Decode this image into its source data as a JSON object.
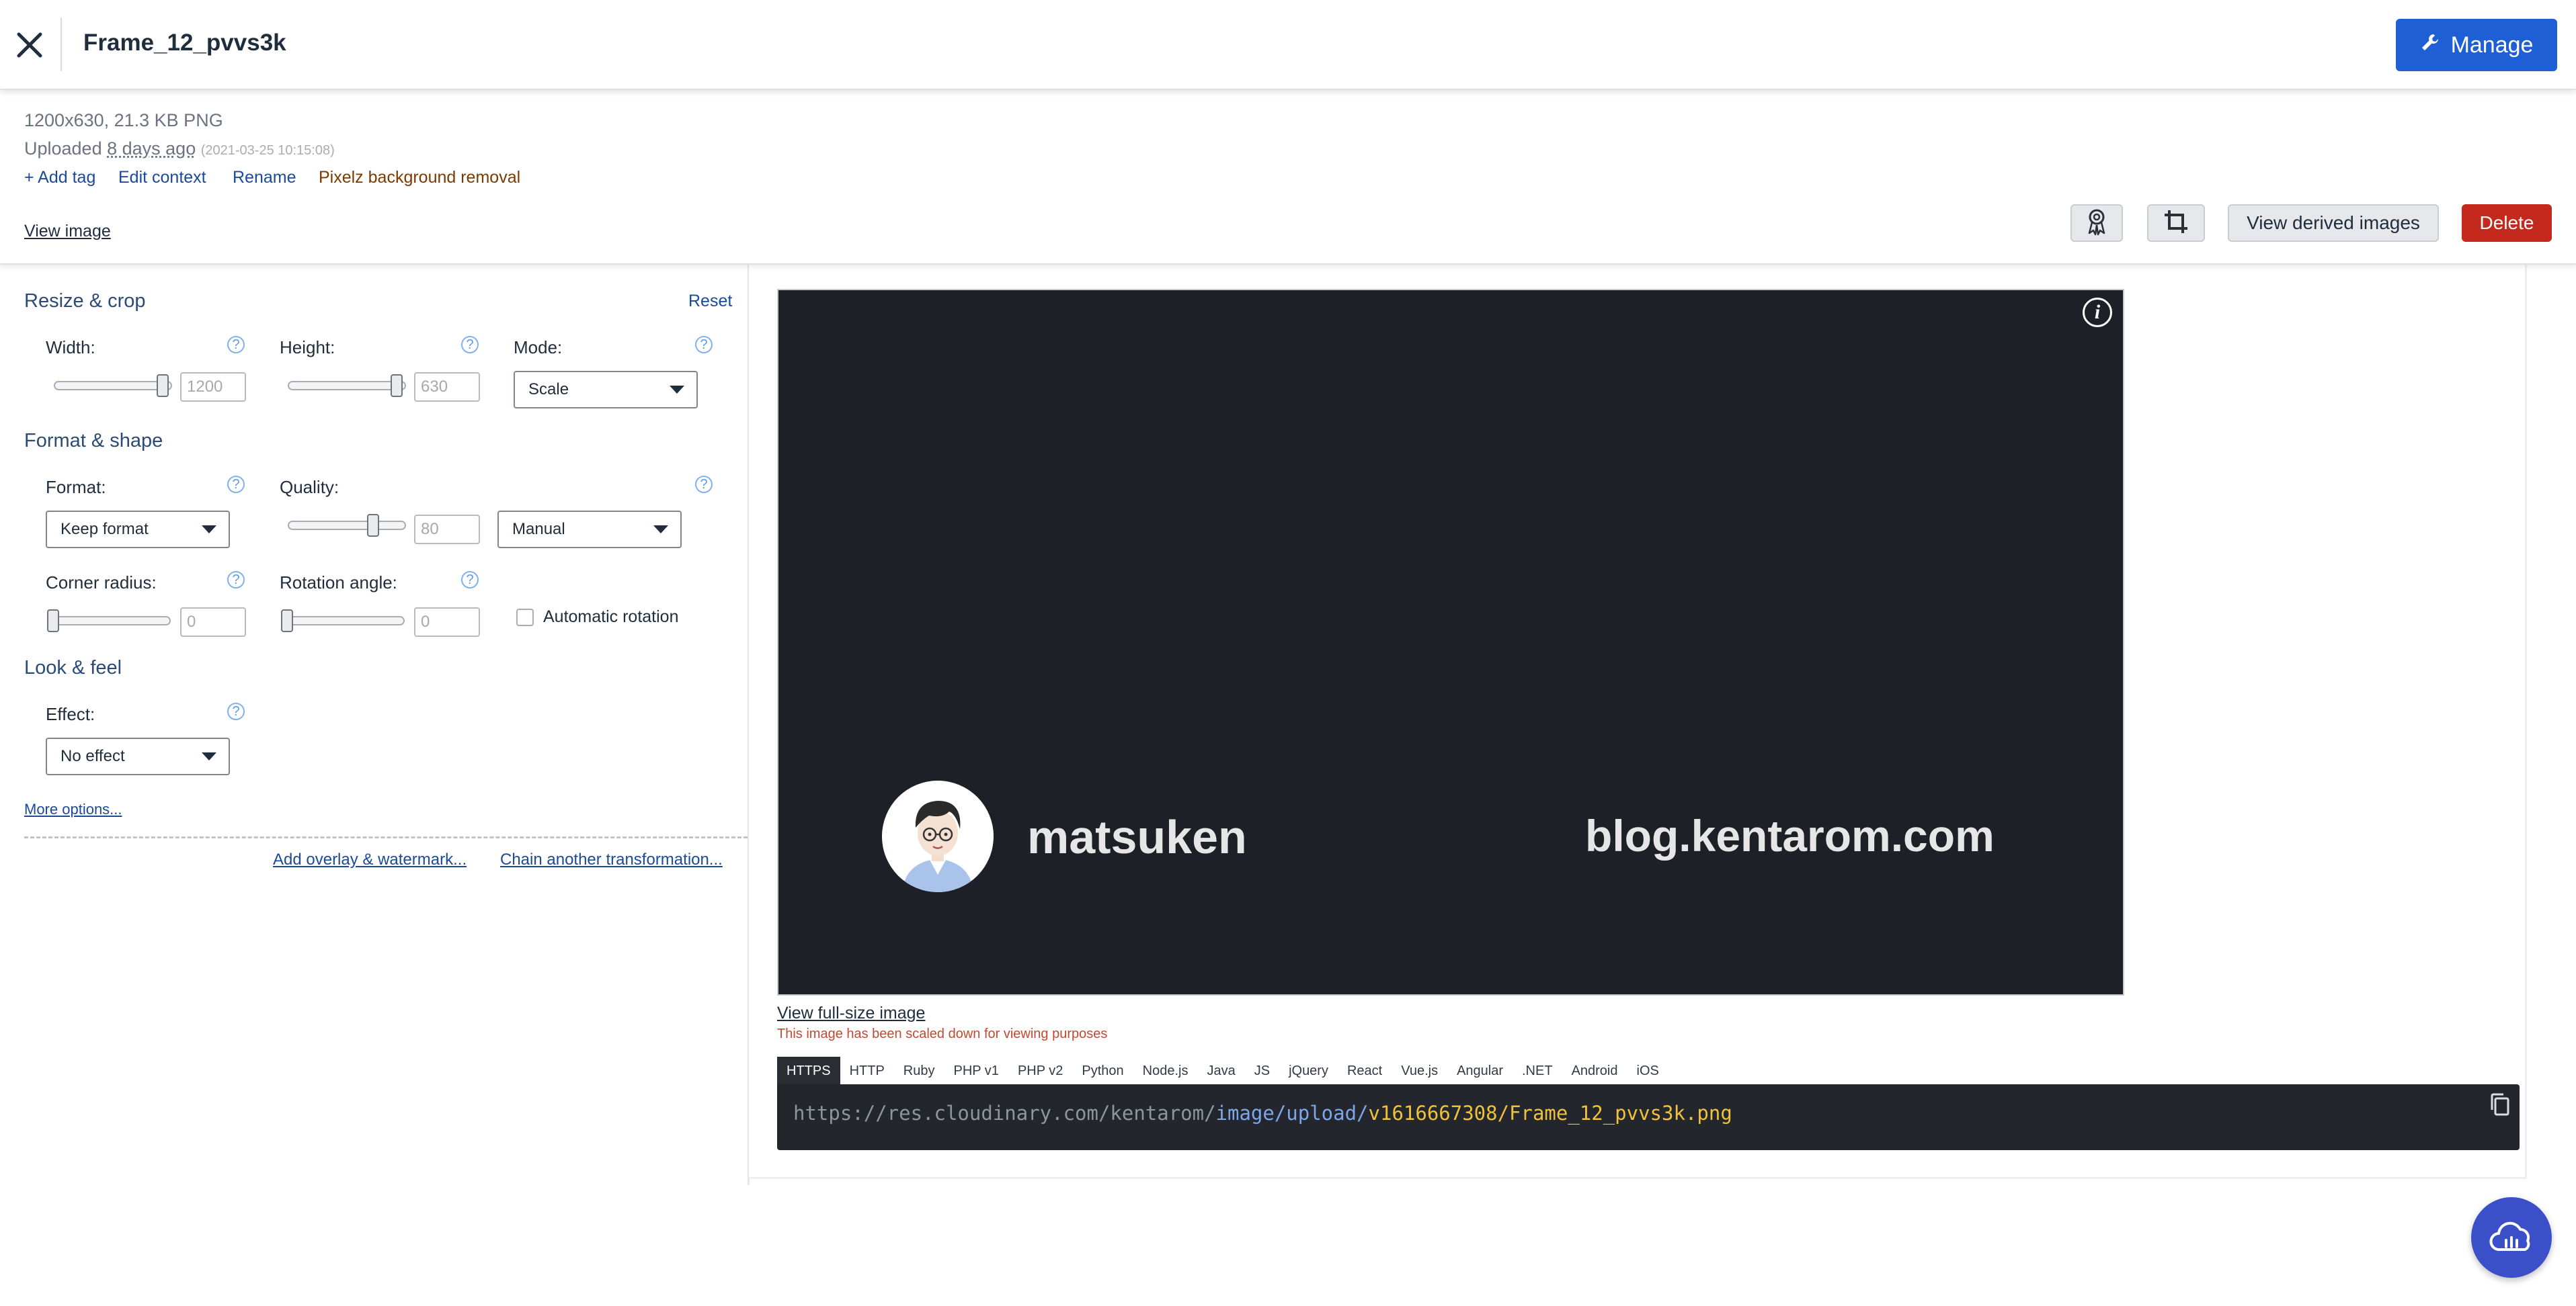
{
  "header": {
    "title": "Frame_12_pvvs3k",
    "manage_label": "Manage"
  },
  "info": {
    "dimensions": "1200x630, 21.3 KB PNG",
    "uploaded_prefix": "Uploaded",
    "uploaded_ago": "8 days ago",
    "uploaded_stamp": "(2021-03-25 10:15:08)",
    "actions": {
      "add_tag": "+ Add tag",
      "edit_context": "Edit context",
      "rename": "Rename",
      "pixelz": "Pixelz background removal"
    },
    "view_image": "View image",
    "view_derived": "View derived images",
    "delete": "Delete"
  },
  "transform": {
    "resize": {
      "title": "Resize & crop",
      "reset": "Reset",
      "width_label": "Width:",
      "width_value": "1200",
      "width_level": 0.92,
      "height_label": "Height:",
      "height_value": "630",
      "height_level": 0.92,
      "mode_label": "Mode:",
      "mode_value": "Scale"
    },
    "format": {
      "title": "Format & shape",
      "format_label": "Format:",
      "format_value": "Keep format",
      "quality_label": "Quality:",
      "quality_value": "80",
      "quality_level": 0.72,
      "quality_mode": "Manual",
      "radius_label": "Corner radius:",
      "radius_value": "0",
      "rotation_label": "Rotation angle:",
      "rotation_value": "0",
      "auto_rotation": "Automatic rotation"
    },
    "look": {
      "title": "Look & feel",
      "effect_label": "Effect:",
      "effect_value": "No effect"
    },
    "more_options": "More options...",
    "add_overlay": "Add overlay & watermark...",
    "chain": "Chain another transformation..."
  },
  "preview": {
    "brand_name": "matsuken",
    "brand_url": "blog.kentarom.com",
    "full_size": "View full-size image",
    "scaled_note": "This image has been scaled down for viewing purposes"
  },
  "code": {
    "tabs": [
      "HTTPS",
      "HTTP",
      "Ruby",
      "PHP v1",
      "PHP v2",
      "Python",
      "Node.js",
      "Java",
      "JS",
      "jQuery",
      "React",
      "Vue.js",
      "Angular",
      ".NET",
      "Android",
      "iOS"
    ],
    "active_tab": "HTTPS",
    "url_base": "https://res.cloudinary.com/kentarom/",
    "url_path": "image/upload/",
    "url_file": "v1616667308/Frame_12_pvvs3k.png"
  },
  "icons": {
    "close": "close-icon",
    "manage": "wrench-icon",
    "award": "award-icon",
    "crop": "crop-icon",
    "info": "info-icon",
    "copy": "copy-icon",
    "cloud": "cloud-icon",
    "help": "help-icon"
  },
  "colors": {
    "primary": "#1f5fd6",
    "danger": "#c4291d",
    "link": "#1a4a9a",
    "preview_bg": "#1e2027",
    "cloud_button": "#3b4fc8"
  }
}
